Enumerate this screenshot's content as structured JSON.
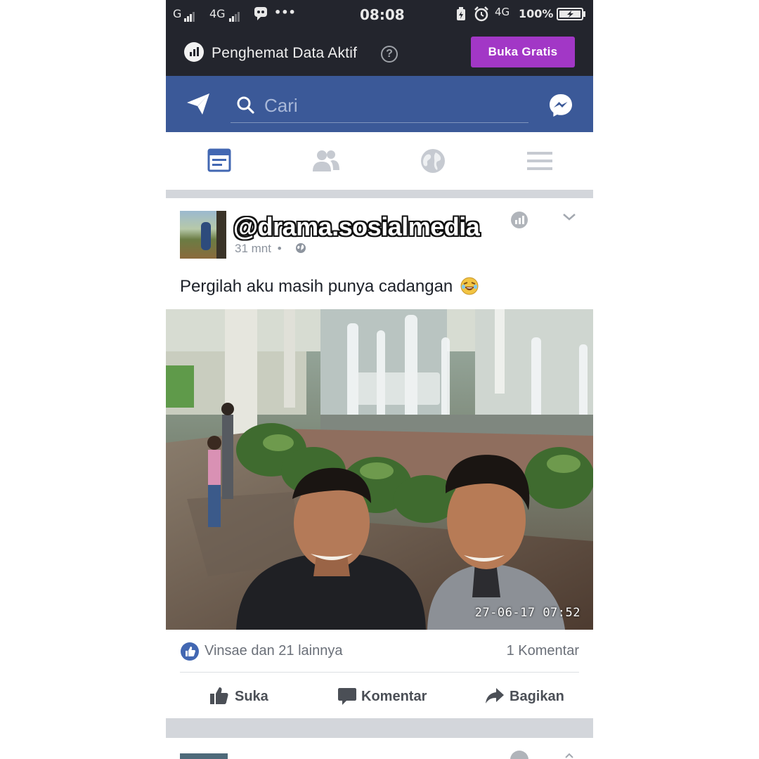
{
  "status_bar": {
    "network_1": "G",
    "network_2": "4G",
    "more": "•••",
    "time": "08:08",
    "network_3": "4G",
    "battery": "100%"
  },
  "data_saver": {
    "title": "Penghemat Data Aktif",
    "help": "?",
    "button_label": "Buka Gratis"
  },
  "header": {
    "search_placeholder": "Cari"
  },
  "tabs": [
    "news-feed",
    "friends",
    "notifications",
    "menu"
  ],
  "post": {
    "author": "@drama.sosialmedia",
    "time": "31 mnt",
    "separator": "•",
    "text": "Pergilah aku masih punya cadangan",
    "photo_timestamp": "27-06-17 07:52",
    "likes_text": "Vinsae dan 21 lainnya",
    "comments_text": "1 Komentar",
    "actions": {
      "like": "Suka",
      "comment": "Komentar",
      "share": "Bagikan"
    }
  },
  "colors": {
    "facebook_blue": "#3b5998",
    "data_saver_bg": "#23252d",
    "buka_button": "#a237c6",
    "like_blue": "#4267b2"
  }
}
